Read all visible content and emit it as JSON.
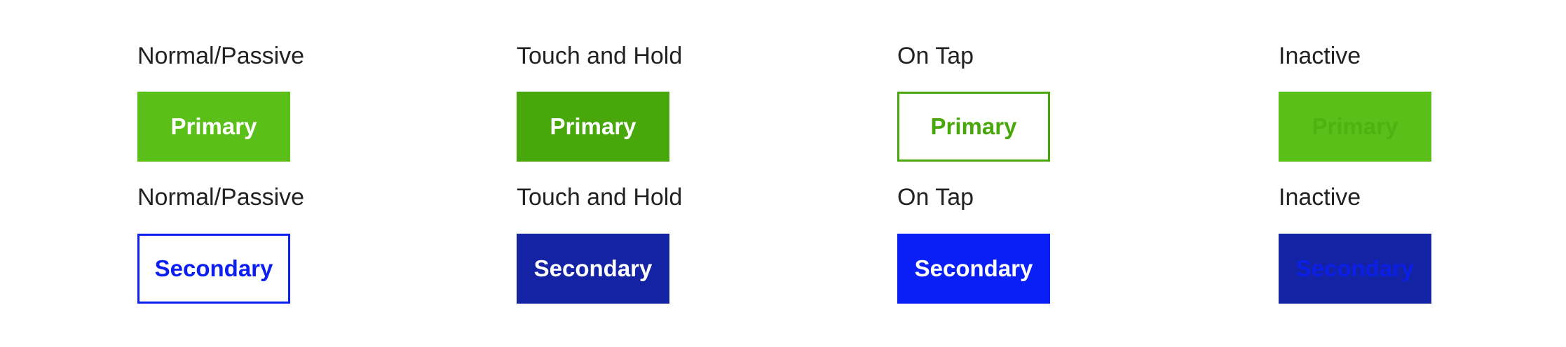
{
  "rows": [
    {
      "states": [
        {
          "label": "Normal/Passive",
          "button": "Primary"
        },
        {
          "label": "Touch and Hold",
          "button": "Primary"
        },
        {
          "label": "On Tap",
          "button": "Primary"
        },
        {
          "label": "Inactive",
          "button": "Primary"
        }
      ]
    },
    {
      "states": [
        {
          "label": "Normal/Passive",
          "button": "Secondary"
        },
        {
          "label": "Touch and Hold",
          "button": "Secondary"
        },
        {
          "label": "On Tap",
          "button": "Secondary"
        },
        {
          "label": "Inactive",
          "button": "Secondary"
        }
      ]
    }
  ],
  "colors": {
    "primary_green": "#5bbf19",
    "primary_green_dark": "#47a70b",
    "secondary_blue": "#0a1ff5",
    "secondary_navy": "#1323a3"
  }
}
